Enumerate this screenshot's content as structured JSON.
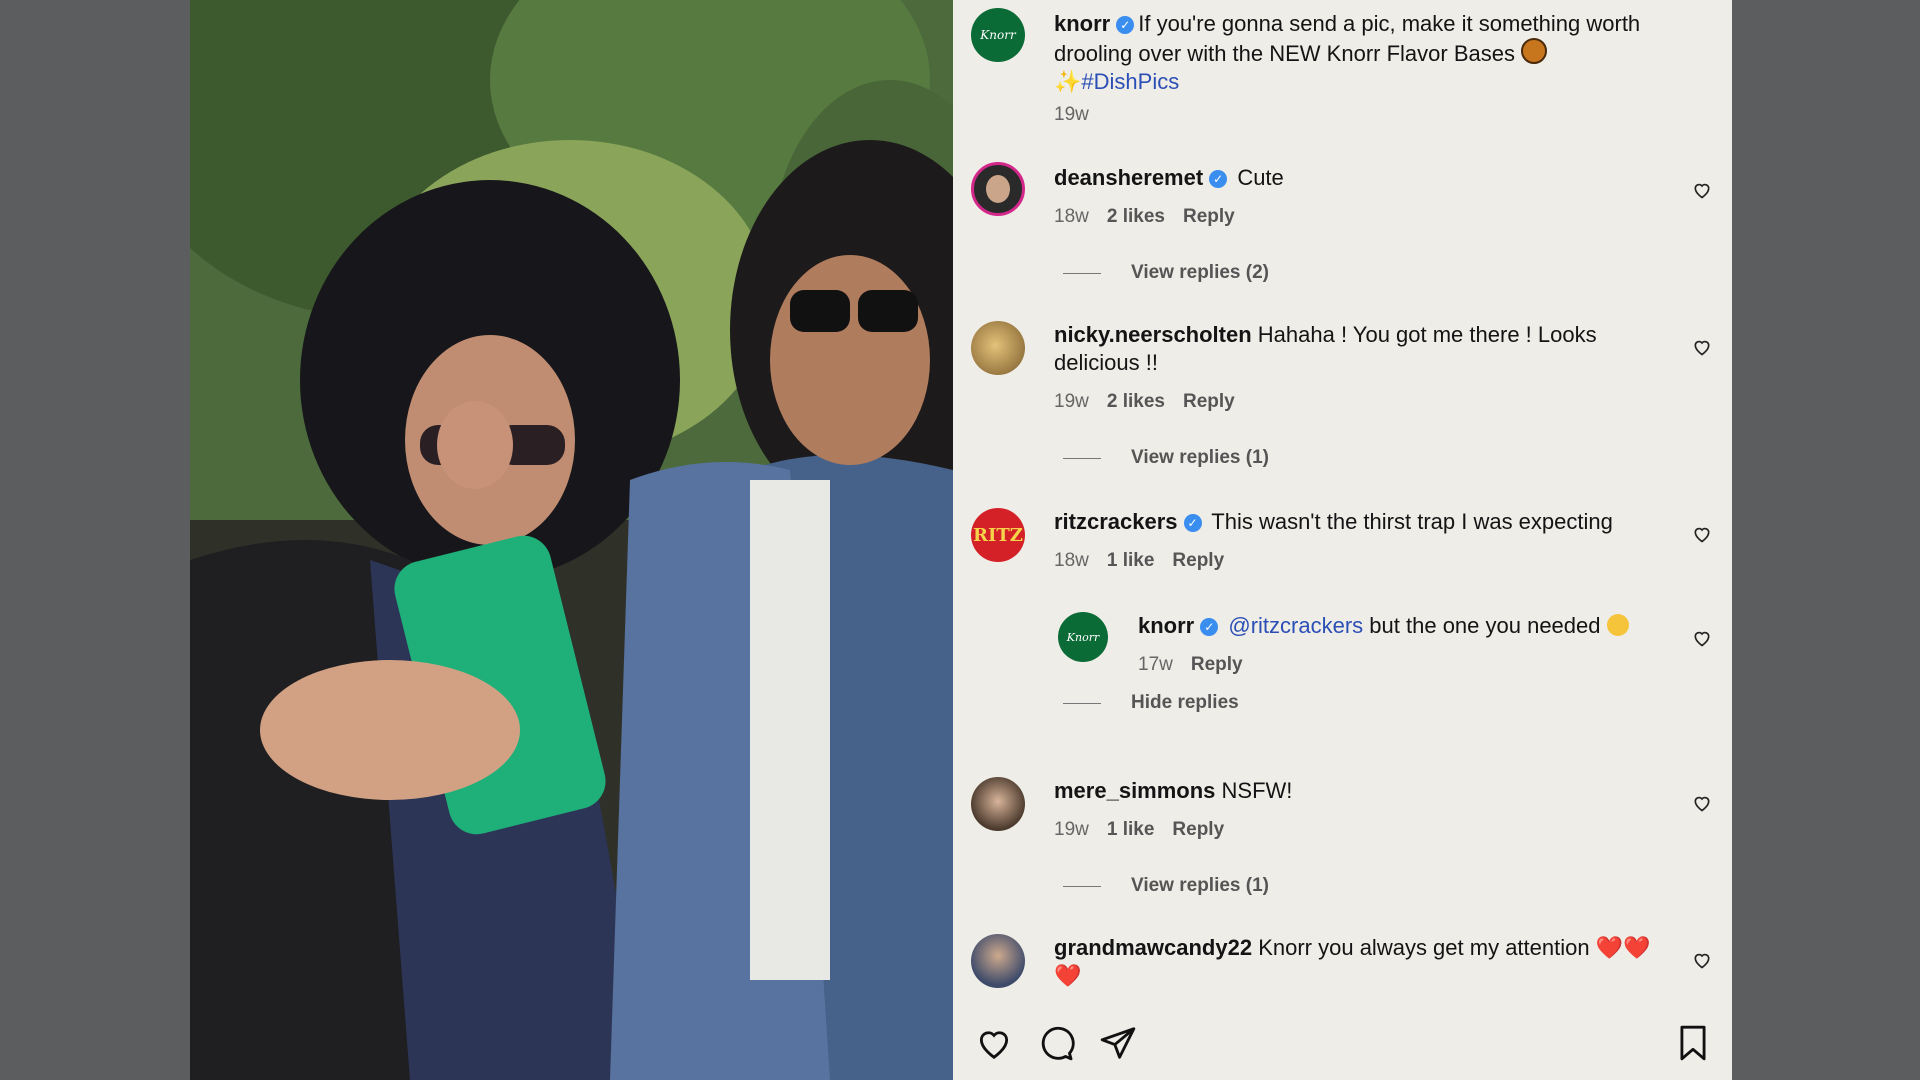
{
  "caption": {
    "username": "knorr",
    "text": "If you're gonna send a pic, make it something worth drooling over with the NEW Knorr Flavor Bases",
    "sparkle": "✨",
    "hashtag": "#DishPics",
    "time": "19w"
  },
  "comments": [
    {
      "username": "deansheremet",
      "verified": true,
      "text": "Cute",
      "time": "18w",
      "likes": "2 likes",
      "reply": "Reply",
      "replies_link": "View replies (2)"
    },
    {
      "username": "nicky.neerscholten",
      "verified": false,
      "text": "Hahaha ! You got me there ! Looks delicious !!",
      "time": "19w",
      "likes": "2 likes",
      "reply": "Reply",
      "replies_link": "View replies (1)"
    },
    {
      "username": "ritzcrackers",
      "verified": true,
      "text": "This wasn't the thirst trap I was expecting",
      "time": "18w",
      "likes": "1 like",
      "reply": "Reply"
    },
    {
      "username": "mere_simmons",
      "verified": false,
      "text": "NSFW!",
      "time": "19w",
      "likes": "1 like",
      "reply": "Reply",
      "replies_link": "View replies (1)"
    },
    {
      "username": "grandmawcandy22",
      "verified": false,
      "text": "Knorr you always get my attention",
      "hearts": "❤️❤️❤️"
    }
  ],
  "reply": {
    "username": "knorr",
    "mention": "@ritzcrackers",
    "text": "but the one you needed",
    "time": "17w",
    "reply": "Reply",
    "hide_link": "Hide replies"
  },
  "avatars": {
    "knorr_logo": "Knorr",
    "ritz_logo": "RITZ"
  },
  "colors": {
    "knorr_green": "#0b6b36",
    "ritz_red": "#d42027",
    "verified_blue": "#3a8ef0",
    "hashtag_blue": "#2c4fb6"
  },
  "icons": [
    "like-icon",
    "comment-icon",
    "share-icon",
    "bookmark-icon",
    "heart-icon",
    "verified-icon"
  ]
}
